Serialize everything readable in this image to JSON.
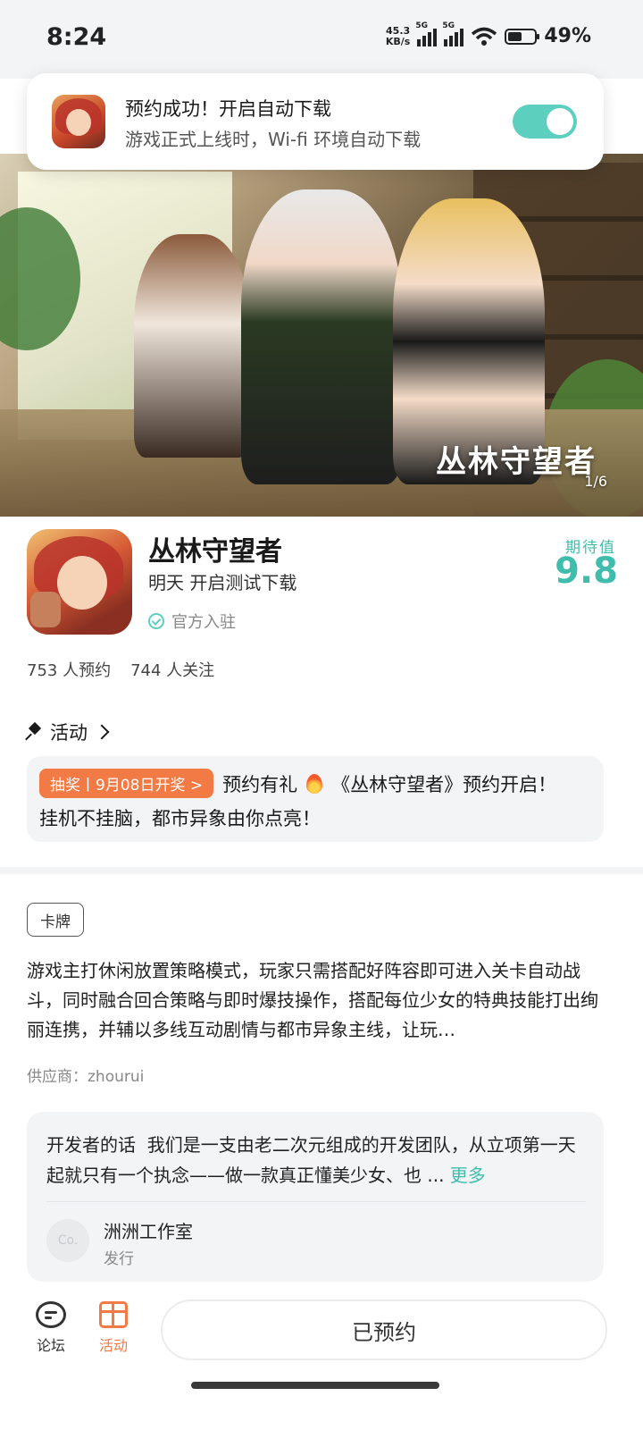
{
  "status": {
    "time": "8:24",
    "net_speed_value": "45.3",
    "net_speed_unit": "KB/s",
    "sim1": "5G",
    "sim2": "5G",
    "battery": "49%"
  },
  "toast": {
    "title": "预约成功！开启自动下载",
    "subtitle": "游戏正式上线时，Wi-fi 环境自动下载",
    "toggle_on": true
  },
  "hero": {
    "logo_text": "丛林守望者",
    "counter": "1/6"
  },
  "game": {
    "title": "丛林守望者",
    "subtitle": "明天 开启测试下载",
    "official_label": "官方入驻",
    "expect_label": "期待值",
    "expect_score": "9.8",
    "reservations": "753 人预约",
    "followers": "744 人关注"
  },
  "activity": {
    "heading": "活动",
    "badge": "抽奖丨9月08日开奖 >",
    "line1_text": "预约有礼",
    "line1_title": "《丛林守望者》预约开启！",
    "line2": "挂机不挂脑，都市异象由你点亮！"
  },
  "details": {
    "tag": "卡牌",
    "description": "游戏主打休闲放置策略模式，玩家只需搭配好阵容即可进入关卡自动战斗，同时融合回合策略与即时爆技操作，搭配每位少女的特典技能打出绚丽连携，并辅以多线互动剧情与都市异象主线，让玩…",
    "supplier": "供应商：zhourui"
  },
  "developer": {
    "label": "开发者的话",
    "text": "我们是一支由老二次元组成的开发团队，从立项第一天起就只有一个执念——做一款真正懂美少女、也 ...",
    "more": "更多",
    "avatar_text": "Co.",
    "studio": "洲洲工作室",
    "role": "发行"
  },
  "bottom": {
    "forum_label": "论坛",
    "activity_label": "活动",
    "reserved_button": "已预约"
  },
  "colors": {
    "accent": "#3fbcab",
    "toggle": "#5ccfbf",
    "orange": "#f27a45"
  },
  "icons": [
    "wifi-icon",
    "battery-icon",
    "pin-icon",
    "chevron-right-icon",
    "fire-icon",
    "verified-icon",
    "forum-icon",
    "gift-icon"
  ]
}
